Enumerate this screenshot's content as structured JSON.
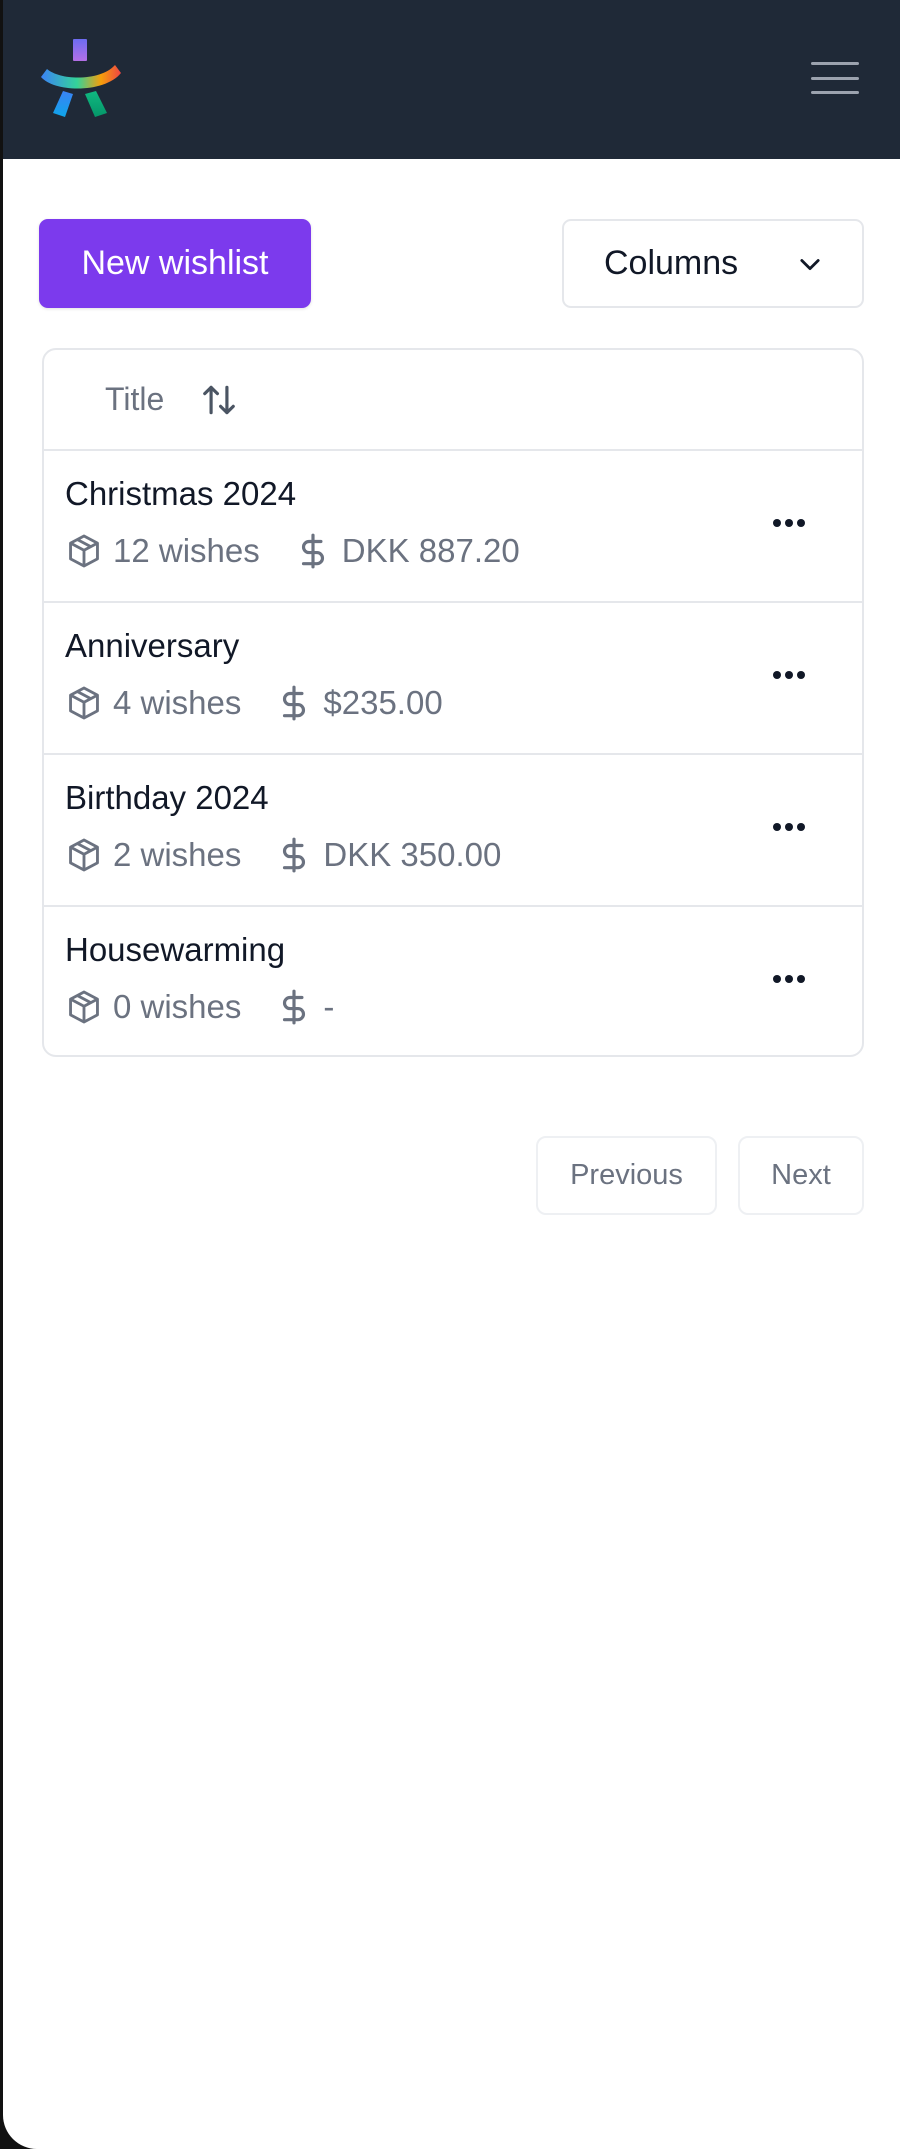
{
  "header": {
    "logo_icon": "app-logo-icon",
    "menu_icon": "hamburger-menu-icon"
  },
  "toolbar": {
    "new_wishlist_label": "New wishlist",
    "columns_label": "Columns",
    "accent_color": "#7c3aed"
  },
  "table": {
    "column_title": "Title",
    "sort_icon": "sort-arrows-icon",
    "rows": [
      {
        "title": "Christmas 2024",
        "wishes": "12 wishes",
        "amount": "DKK 887.20"
      },
      {
        "title": "Anniversary",
        "wishes": "4 wishes",
        "amount": "$235.00"
      },
      {
        "title": "Birthday 2024",
        "wishes": "2 wishes",
        "amount": "DKK 350.00"
      },
      {
        "title": "Housewarming",
        "wishes": "0 wishes",
        "amount": "-"
      }
    ]
  },
  "pagination": {
    "previous_label": "Previous",
    "next_label": "Next"
  }
}
